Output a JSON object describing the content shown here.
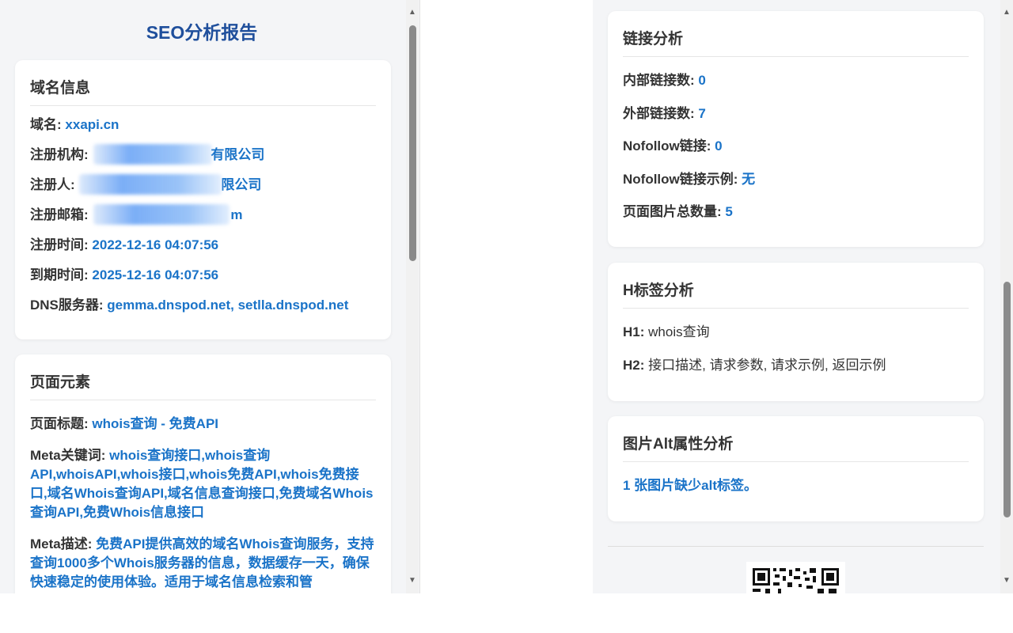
{
  "report_title": "SEO分析报告",
  "domain_info": {
    "heading": "域名信息",
    "domain_label": "域名:",
    "domain_value": "xxapi.cn",
    "registrar_label": "注册机构:",
    "registrar_value": "有限公司",
    "registrant_label": "注册人:",
    "registrant_value": "限公司",
    "email_label": "注册邮箱:",
    "email_value": "m",
    "reg_time_label": "注册时间:",
    "reg_time_value": "2022-12-16 04:07:56",
    "exp_time_label": "到期时间:",
    "exp_time_value": "2025-12-16 04:07:56",
    "dns_label": "DNS服务器:",
    "dns_value": "gemma.dnspod.net, setlla.dnspod.net"
  },
  "page_elements": {
    "heading": "页面元素",
    "title_label": "页面标题:",
    "title_value": "whois查询 - 免费API",
    "keywords_label": "Meta关键词:",
    "keywords_value": "whois查询接口,whois查询API,whoisAPI,whois接口,whois免费API,whois免费接口,域名Whois查询API,域名信息查询接口,免费域名Whois查询API,免费Whois信息接口",
    "desc_label": "Meta描述:",
    "desc_value": "免费API提供高效的域名Whois查询服务，支持查询1000多个Whois服务器的信息，数据缓存一天，确保快速稳定的使用体验。适用于域名信息检索和管"
  },
  "link_analysis": {
    "heading": "链接分析",
    "internal_label": "内部链接数:",
    "internal_value": "0",
    "external_label": "外部链接数:",
    "external_value": "7",
    "nofollow_label": "Nofollow链接:",
    "nofollow_value": "0",
    "nofollow_example_label": "Nofollow链接示例:",
    "nofollow_example_value": "无",
    "images_label": "页面图片总数量:",
    "images_value": "5"
  },
  "h_tags": {
    "heading": "H标签分析",
    "h1_label": "H1:",
    "h1_value": "whois查询",
    "h2_label": "H2:",
    "h2_value": "接口描述, 请求参数, 请求示例, 返回示例"
  },
  "alt_analysis": {
    "heading": "图片Alt属性分析",
    "message": "1 张图片缺少alt标签。"
  },
  "scroll": {
    "up_arrow": "▲",
    "down_arrow": "▼"
  },
  "colors": {
    "accent": "#1a73c8",
    "title": "#1f4f9c",
    "panel_bg": "#f4f5f7"
  }
}
